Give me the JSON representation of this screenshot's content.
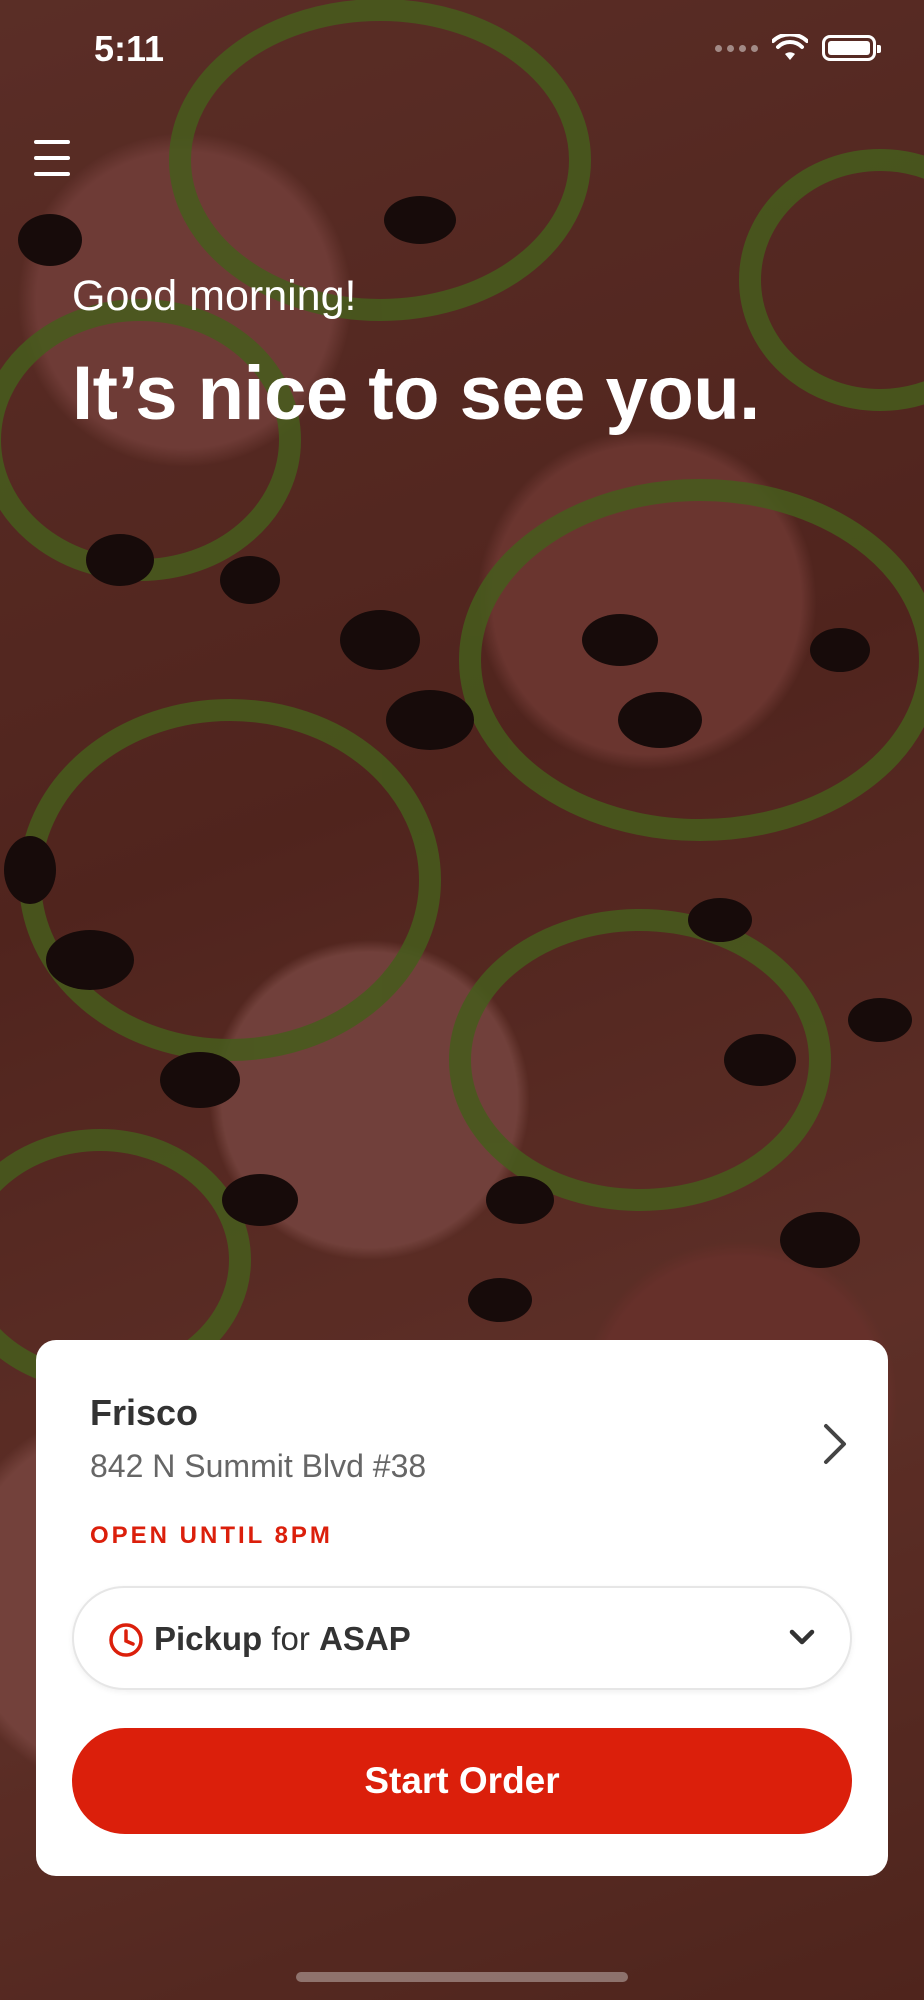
{
  "status_bar": {
    "time": "5:11"
  },
  "hero": {
    "greeting": "Good morning!",
    "headline": "It’s nice to see you."
  },
  "store": {
    "name": "Frisco",
    "address": "842 N Summit Blvd #38",
    "hours_status": "OPEN UNTIL 8PM"
  },
  "order": {
    "mode": "Pickup",
    "connector": "for",
    "timing": "ASAP",
    "start_label": "Start Order"
  },
  "colors": {
    "accent": "#db1f0b",
    "card_background": "#ffffff"
  },
  "icons": [
    "menu-icon",
    "wifi-icon",
    "battery-icon",
    "chevron-right-icon",
    "clock-icon",
    "chevron-down-icon"
  ]
}
